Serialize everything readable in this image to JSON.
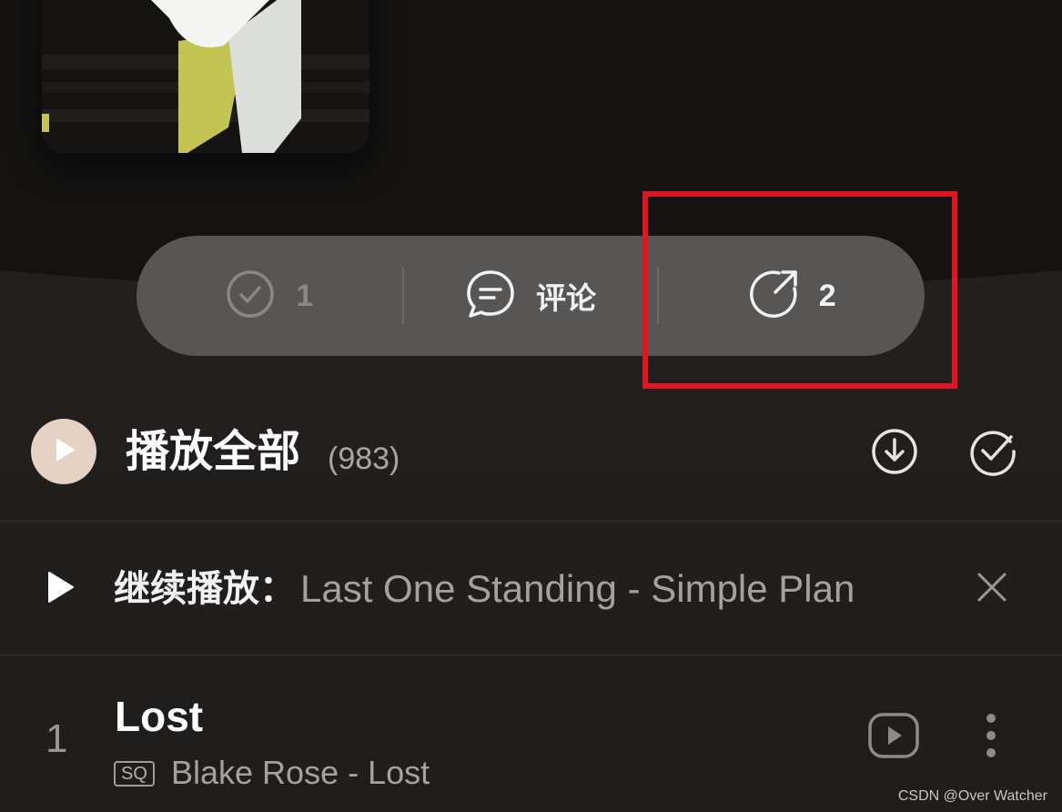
{
  "actions": {
    "collect_count": "1",
    "comment_label": "评论",
    "share_count": "2"
  },
  "playall": {
    "title": "播放全部",
    "count": "(983)"
  },
  "continue_play": {
    "label": "继续播放：",
    "track": "Last One Standing - Simple Plan"
  },
  "songs": [
    {
      "index": "1",
      "title": "Lost",
      "quality": "SQ",
      "artist_album": "Blake Rose - Lost"
    }
  ],
  "watermark": "CSDN @Over Watcher",
  "colors": {
    "highlight": "#e0151f",
    "pill_bg": "#585655",
    "play_button_bg": "#e5d2c3"
  },
  "icons": {
    "collect": "check-circle-icon",
    "comment": "chat-bubble-icon",
    "share": "share-arrow-icon",
    "download": "download-circle-icon",
    "multiselect": "check-circle-icon",
    "close": "close-icon",
    "mv": "video-play-icon",
    "more": "more-vertical-icon"
  }
}
